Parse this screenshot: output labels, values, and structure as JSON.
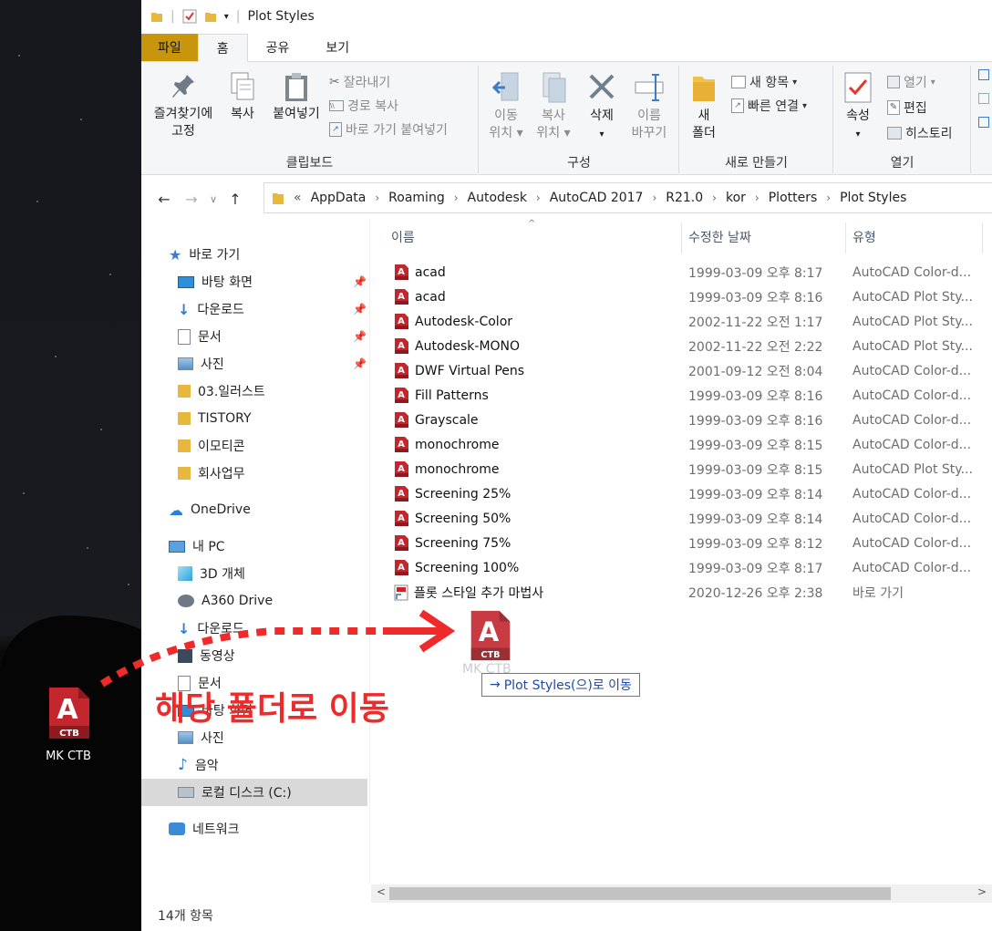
{
  "window": {
    "title": "Plot Styles"
  },
  "ribbon_tabs": [
    "파일",
    "홈",
    "공유",
    "보기"
  ],
  "ribbon": {
    "clipboard": {
      "pin_label_1": "즐겨찾기에",
      "pin_label_2": "고정",
      "copy": "복사",
      "paste": "붙여넣기",
      "cut": "잘라내기",
      "copy_path": "경로 복사",
      "paste_shortcut": "바로 가기 붙여넣기",
      "group": "클립보드"
    },
    "organize": {
      "move_1": "이동",
      "move_2": "위치",
      "copyto_1": "복사",
      "copyto_2": "위치",
      "delete": "삭제",
      "rename_1": "이름",
      "rename_2": "바꾸기",
      "group": "구성"
    },
    "new": {
      "new_folder_1": "새",
      "new_folder_2": "폴더",
      "new_item": "새 항목",
      "easy_access": "빠른 연결",
      "group": "새로 만들기"
    },
    "open": {
      "properties": "속성",
      "open": "열기",
      "edit": "편집",
      "history": "히스토리",
      "group": "열기"
    }
  },
  "address": {
    "overflow": "«",
    "crumbs": [
      "AppData",
      "Roaming",
      "Autodesk",
      "AutoCAD 2017",
      "R21.0",
      "kor",
      "Plotters",
      "Plot Styles"
    ]
  },
  "nav": {
    "quick_access": "바로 가기",
    "items": [
      "바탕 화면",
      "다운로드",
      "문서",
      "사진",
      "03.일러스트",
      "TISTORY",
      "이모티콘",
      "회사업무"
    ],
    "onedrive": "OneDrive",
    "this_pc": "내 PC",
    "pc_items": [
      "3D 개체",
      "A360 Drive",
      "다운로드",
      "동영상",
      "문서",
      "바탕 화면",
      "사진",
      "음악",
      "로컬 디스크 (C:)"
    ],
    "network": "네트워크"
  },
  "columns": {
    "name": "이름",
    "date": "수정한 날짜",
    "type": "유형"
  },
  "files": [
    {
      "name": "acad",
      "date": "1999-03-09 오후 8:17",
      "type": "AutoCAD Color-d..."
    },
    {
      "name": "acad",
      "date": "1999-03-09 오후 8:16",
      "type": "AutoCAD Plot Sty..."
    },
    {
      "name": "Autodesk-Color",
      "date": "2002-11-22 오전 1:17",
      "type": "AutoCAD Plot Sty..."
    },
    {
      "name": "Autodesk-MONO",
      "date": "2002-11-22 오전 2:22",
      "type": "AutoCAD Plot Sty..."
    },
    {
      "name": "DWF Virtual Pens",
      "date": "2001-09-12 오전 8:04",
      "type": "AutoCAD Color-d..."
    },
    {
      "name": "Fill Patterns",
      "date": "1999-03-09 오후 8:16",
      "type": "AutoCAD Color-d..."
    },
    {
      "name": "Grayscale",
      "date": "1999-03-09 오후 8:16",
      "type": "AutoCAD Color-d..."
    },
    {
      "name": "monochrome",
      "date": "1999-03-09 오후 8:15",
      "type": "AutoCAD Color-d..."
    },
    {
      "name": "monochrome",
      "date": "1999-03-09 오후 8:15",
      "type": "AutoCAD Plot Sty..."
    },
    {
      "name": "Screening 25%",
      "date": "1999-03-09 오후 8:14",
      "type": "AutoCAD Color-d..."
    },
    {
      "name": "Screening 50%",
      "date": "1999-03-09 오후 8:14",
      "type": "AutoCAD Color-d..."
    },
    {
      "name": "Screening 75%",
      "date": "1999-03-09 오후 8:12",
      "type": "AutoCAD Color-d..."
    },
    {
      "name": "Screening 100%",
      "date": "1999-03-09 오후 8:17",
      "type": "AutoCAD Color-d..."
    },
    {
      "name": "플롯 스타일 추가 마법사",
      "date": "2020-12-26 오후 2:38",
      "type": "바로 가기"
    }
  ],
  "status": "14개 항목",
  "desktop_icon": {
    "label": "MK CTB",
    "badge": "CTB"
  },
  "drag": {
    "ghost_label": "MK CTB",
    "tooltip": "Plot Styles(으)로 이동",
    "annotation": "해당 폴더로 이동"
  },
  "colors": {
    "accent": "#c8960d",
    "autocad_red": "#c0262d",
    "annotation": "#ef2a2a"
  }
}
